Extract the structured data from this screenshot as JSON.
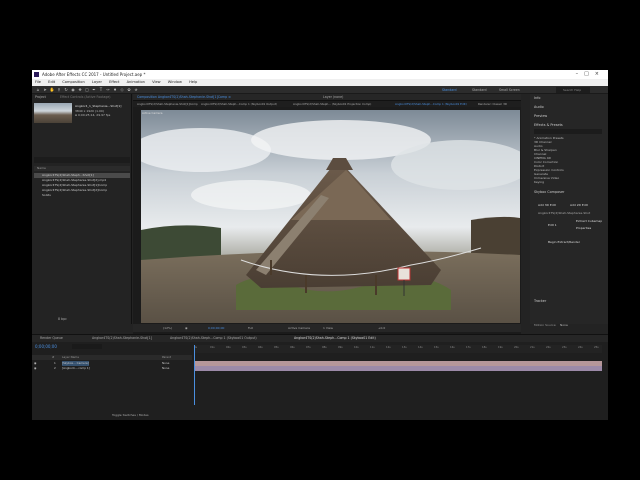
{
  "window": {
    "title": "Adobe After Effects CC 2017 - Untitled Project.aep *"
  },
  "menu": [
    "File",
    "Edit",
    "Composition",
    "Layer",
    "Effect",
    "Animation",
    "View",
    "Window",
    "Help"
  ],
  "toolbar": {
    "workspaces": [
      "Standard",
      "Standard",
      "Small Screen"
    ],
    "search_placeholder": "Search Help"
  },
  "project": {
    "tab": "Project",
    "effect_controls_tab": "Effect Controls (Active Footage)",
    "selected_name": "Angkor4_1_Stephanie...Shot[1]",
    "info_lines": [
      "3840 x 1920 (1.00)",
      "Δ 0;00;25;14, 29.97 fps"
    ],
    "column_name": "Name",
    "items": [
      "Angkor4TS(2)Shah-Steph...Shot[1]",
      "Angkor4TS(2)Shah-Stephanie-Shot[2].mp4",
      "Angkor4TS(2)Shah-Stephanie-Shot[1]Comp",
      "Angkor4TS(2)Shah-Stephanie-Shot[2]Comp",
      "Solids"
    ],
    "depth": "8 bpc"
  },
  "composition": {
    "tab_label": "Composition  Angkor4TS(2)Shah-Stephanie-Shot[1]Comp ≡",
    "layer_tab": "Layer (none)",
    "breadcrumbs": [
      "Angkor4TS(2)Shah-Stephanie-Shot[1]Comp",
      "Angkor4TS(2)Shah-Steph...Comp 1 (Skybox01 Output)",
      "Angkor4TS(2)Shah-Steph... (Skybox01 Projection Comp)",
      "Angkor4TS(2)Shah-Steph...Comp 1 (Skybox01 Edit)"
    ],
    "renderer": "Renderer:  Classic 3D",
    "active_camera": "Active Camera",
    "zoom": "(12%)",
    "timecode": "0;00;00;00",
    "resolution": "Full",
    "camera_option": "Active Camera",
    "view": "1 View",
    "exposure": "+0.0"
  },
  "right_panels": {
    "sections": [
      "Info",
      "Audio",
      "Preview",
      "Effects & Presets"
    ],
    "effects": [
      "* Animation Presets",
      "3D Channel",
      "Audio",
      "Blur & Sharpen",
      "Channel",
      "CINEMA 4D",
      "Color Correction",
      "Distort",
      "Expression Controls",
      "Generate",
      "Immersive Video",
      "Keying"
    ],
    "vr_comp_editor": {
      "title": "Skybox Composer",
      "add_3d": "Add 3D Edit",
      "add_2d": "Add 2D Edit",
      "comp_name": "Angkor4TS(2)Shah-Stephanie-Shot",
      "edit_label": "Edit 1",
      "extract": "Extract Cubemap",
      "properties": "Properties",
      "extract_btn": "Begin Extract/Render"
    },
    "tracker": {
      "title": "Tracker",
      "motion_source": "Motion Source:",
      "motion_source_value": "None"
    }
  },
  "timeline": {
    "tabs": [
      "Render Queue",
      "Angkor4TS(2)Shah-Stephanie-Shot[1]",
      "Angkor4TS(2)Shah-Steph...Comp 1 (Skybox01 Output)",
      "Angkor4TS(2)Shah-Steph...Comp 1 (Skybox01 Edit)"
    ],
    "timecode": "0;00;00;00",
    "header": [
      "#",
      "Layer Name",
      "Parent"
    ],
    "layers": [
      {
        "num": "1",
        "name": "[Skybox... Camera]",
        "parent": "None"
      },
      {
        "num": "2",
        "name": "[Angkor4....comp 1]",
        "parent": "None"
      }
    ],
    "ticks": [
      "0s",
      "01s",
      "02s",
      "03s",
      "04s",
      "05s",
      "06s",
      "07s",
      "08s",
      "09s",
      "10s",
      "11s",
      "12s",
      "13s",
      "14s",
      "15s",
      "16s",
      "17s",
      "18s",
      "19s",
      "20s",
      "21s",
      "22s",
      "23s",
      "24s",
      "25s"
    ],
    "toggle": "Toggle Switches / Modes"
  },
  "colors": {
    "accent": "#4a8fe0",
    "layer_bar_1": "#b6979a",
    "layer_bar_2": "#9c8aa8"
  }
}
